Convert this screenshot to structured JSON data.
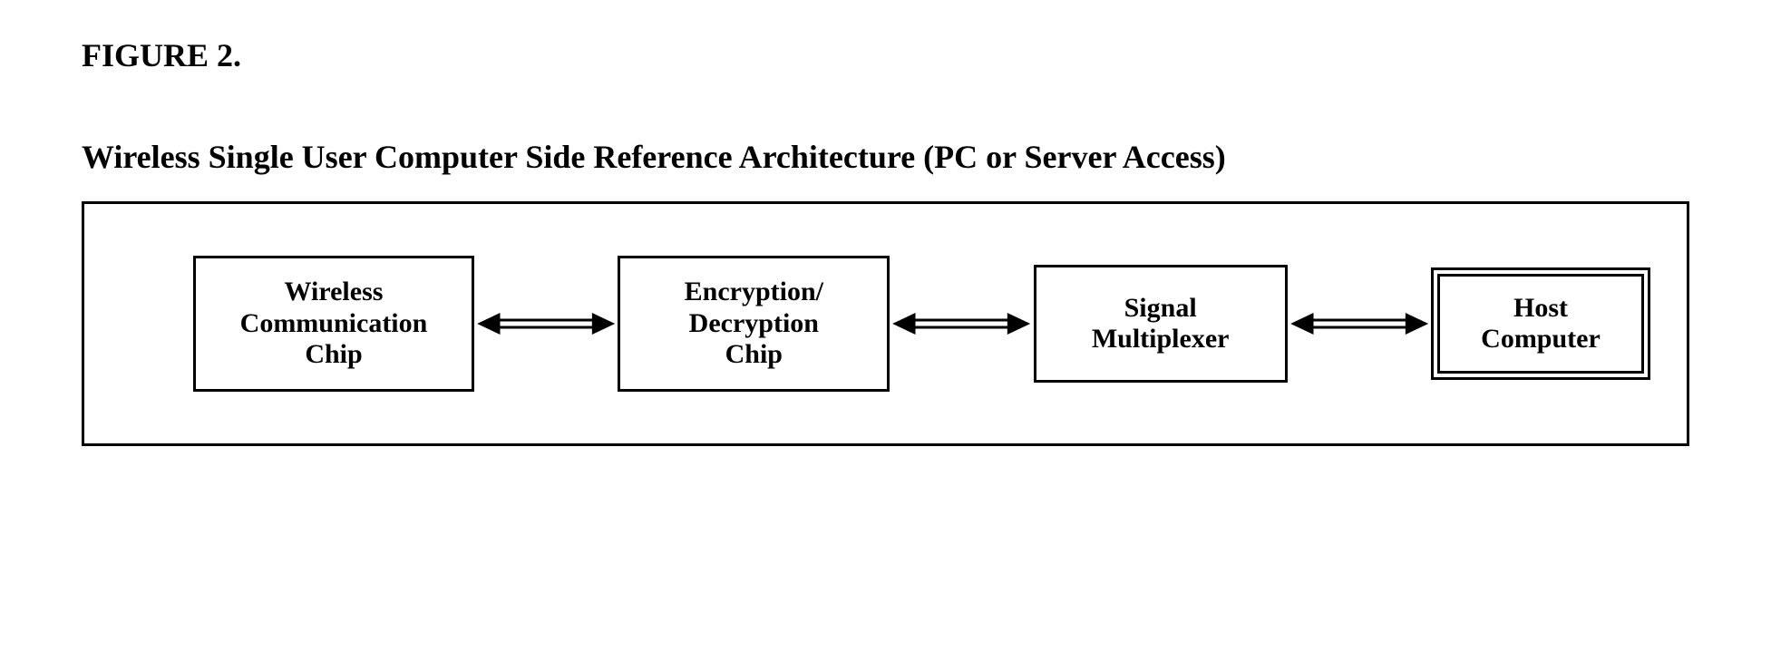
{
  "figure_label": "FIGURE 2.",
  "subtitle": "Wireless Single User Computer Side Reference Architecture (PC or Server Access)",
  "blocks": {
    "wireless": "Wireless\nCommunication\nChip",
    "crypto": "Encryption/\nDecryption\nChip",
    "mux": "Signal\nMultiplexer",
    "host": "Host\nComputer"
  }
}
